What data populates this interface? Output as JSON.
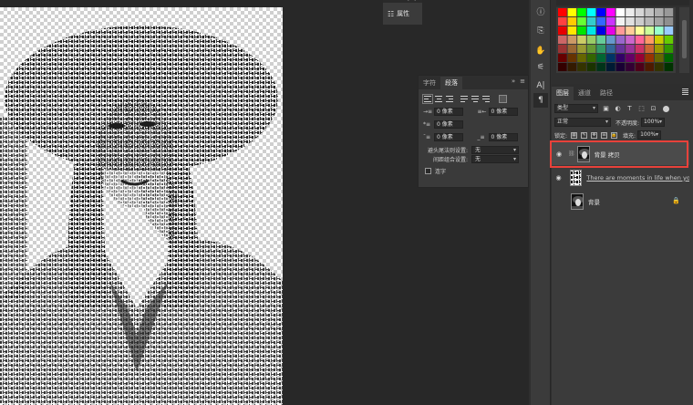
{
  "properties_mini": {
    "label": "属性"
  },
  "paragraph_panel": {
    "tabs": [
      {
        "label": "字符"
      },
      {
        "label": "段落"
      }
    ],
    "collapse_glyph": "»",
    "fields": {
      "indent_left": "0 像素",
      "indent_right": "0 像素",
      "indent_first": "0 像素",
      "space_before": "0 像素",
      "space_after": "0 像素"
    },
    "field_icons": {
      "indent_left": "→≡",
      "indent_right": "≡←",
      "indent_first": "*≡",
      "space_before": "¯≡",
      "space_after": "_≡"
    },
    "kinsoku_label": "避头尾法则设置:",
    "kinsoku_value": "无",
    "mojikumi_label": "间距组合设置:",
    "mojikumi_value": "无",
    "hyphenate_label": "连字"
  },
  "layers_panel": {
    "tabs": [
      {
        "label": "图层"
      },
      {
        "label": "通道"
      },
      {
        "label": "路径"
      }
    ],
    "filter_kind": "类型",
    "filter_icons": [
      "image-filter-icon",
      "adjust-filter-icon",
      "type-filter-icon",
      "shape-filter-icon",
      "smart-filter-icon"
    ],
    "blend_mode": "正常",
    "opacity_label": "不透明度:",
    "opacity_value": "100%",
    "lock_label": "锁定:",
    "fill_label": "填充:",
    "fill_value": "100%",
    "layers": [
      {
        "name": "背景 拷贝",
        "visible": true,
        "selected": true,
        "locked": false
      },
      {
        "name": "There are moments in life when yo...",
        "visible": true,
        "selected": false,
        "locked": false
      },
      {
        "name": "背景",
        "visible": false,
        "selected": false,
        "locked": true
      }
    ]
  },
  "colors": {
    "accent_highlight": "#e8413a",
    "panel_bg": "#3b3b3b",
    "workspace_bg": "#282828"
  }
}
